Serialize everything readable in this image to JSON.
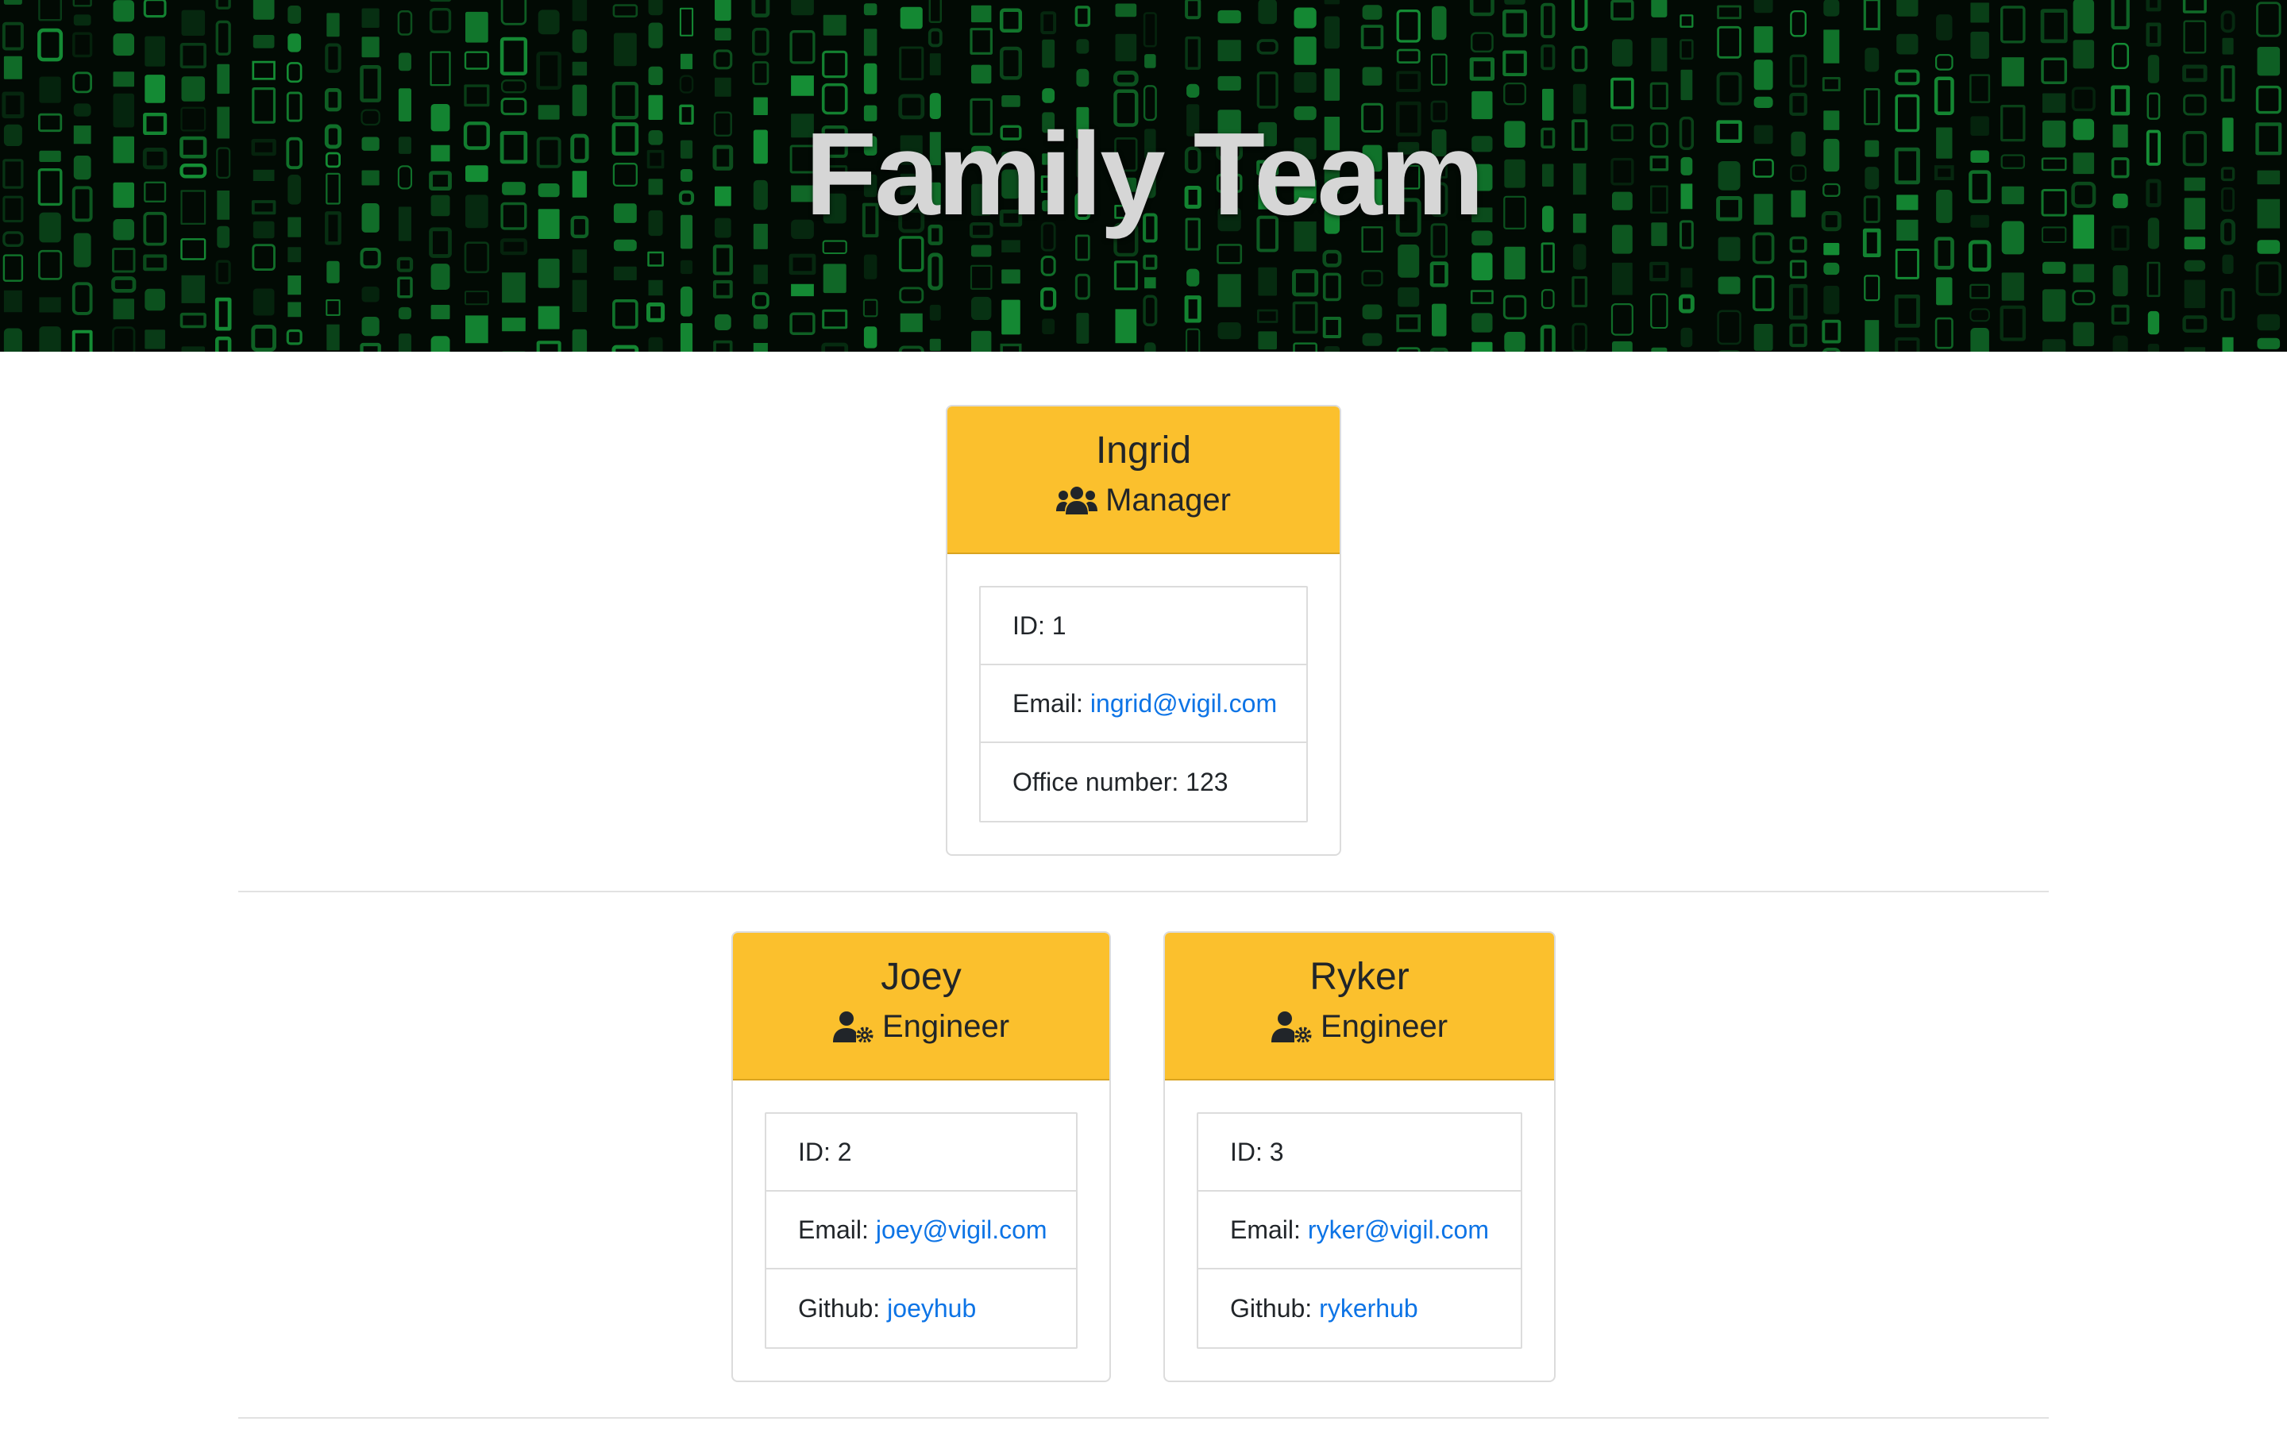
{
  "page": {
    "title": "Family Team"
  },
  "colors": {
    "card_header": "#fbc02d",
    "link": "#0d74e6",
    "hero_glyphs": "#1fd04e"
  },
  "manager": {
    "name": "Ingrid",
    "role": "Manager",
    "role_icon": "users-icon",
    "id_label": "ID: 1",
    "email_label": "Email:",
    "email": "ingrid@vigil.com",
    "office_label": "Office number: 123"
  },
  "engineers": [
    {
      "name": "Joey",
      "role": "Engineer",
      "role_icon": "user-gear-icon",
      "id_label": "ID: 2",
      "email_label": "Email:",
      "email": "joey@vigil.com",
      "github_label": "Github:",
      "github": "joeyhub"
    },
    {
      "name": "Ryker",
      "role": "Engineer",
      "role_icon": "user-gear-icon",
      "id_label": "ID: 3",
      "email_label": "Email:",
      "email": "ryker@vigil.com",
      "github_label": "Github:",
      "github": "rykerhub"
    }
  ]
}
